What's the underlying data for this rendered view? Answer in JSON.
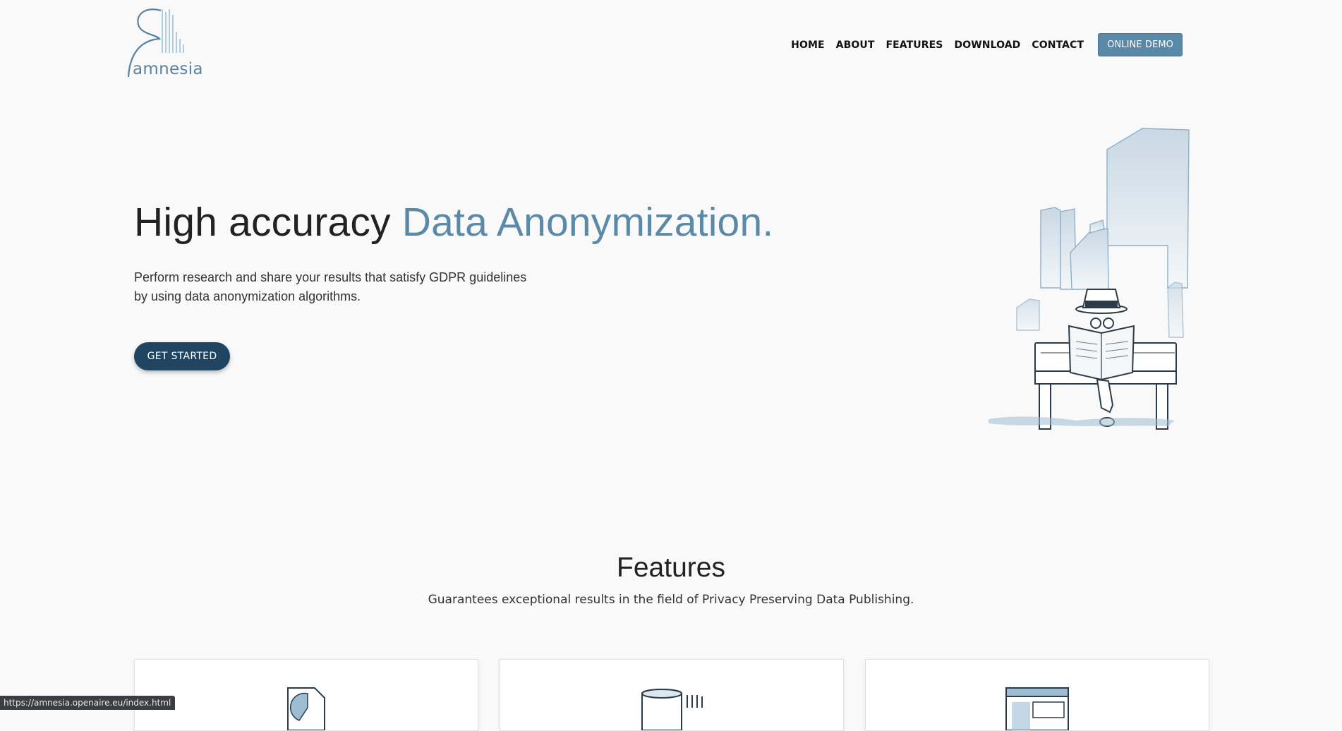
{
  "header": {
    "logo_text": "amnesia",
    "nav": {
      "home": "HOME",
      "about": "ABOUT",
      "features": "FEATURES",
      "download": "DOWNLOAD",
      "contact": "CONTACT",
      "demo": "ONLINE DEMO"
    }
  },
  "hero": {
    "title_plain": "High accuracy ",
    "title_accent": "Data Anonymization.",
    "subtitle_line1": "Perform research and share your results that satisfy GDPR guidelines",
    "subtitle_line2": "by using data anonymization algorithms.",
    "cta": "GET STARTED",
    "illustration_icon": "man-reading-newspaper-on-bench-illustration"
  },
  "features": {
    "title": "Features",
    "subtitle": "Guarantees exceptional results in the field of Privacy Preserving Data Publishing.",
    "cards": [
      {
        "icon": "pie-chart-document-icon"
      },
      {
        "icon": "database-icon"
      },
      {
        "icon": "browser-window-icon"
      }
    ]
  },
  "status_url": "https://amnesia.openaire.eu/index.html",
  "colors": {
    "accent": "#5a8aa8",
    "cta": "#1f4563",
    "background": "#f9f9f9"
  }
}
